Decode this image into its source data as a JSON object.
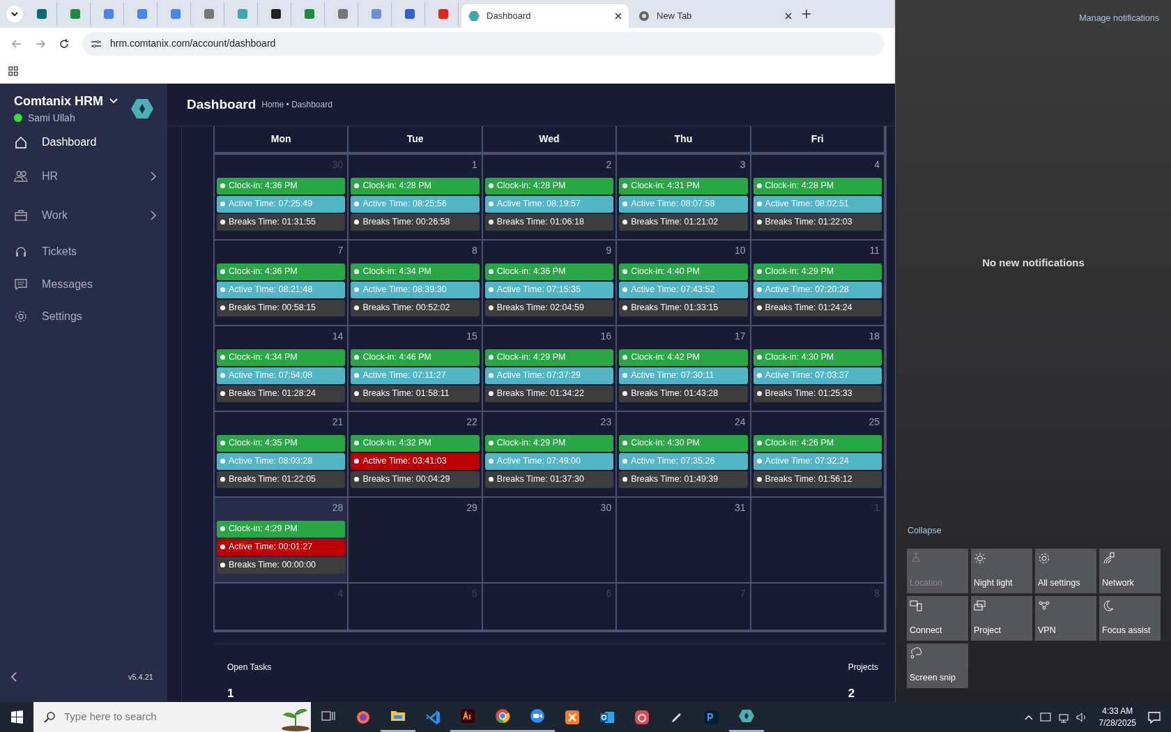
{
  "browser": {
    "tabs": [
      {
        "label": "Dashboard",
        "selected": true
      },
      {
        "label": "New Tab",
        "selected": false
      }
    ],
    "url": "hrm.comtanix.com/account/dashboard"
  },
  "sidebar": {
    "brand": "Comtanix HRM",
    "user": "Sami Ullah",
    "online": true,
    "items": [
      {
        "label": "Dashboard",
        "selected": true,
        "submenu": false
      },
      {
        "label": "HR",
        "selected": false,
        "submenu": true
      },
      {
        "label": "Work",
        "selected": false,
        "submenu": true
      },
      {
        "label": "Tickets",
        "selected": false,
        "submenu": false
      },
      {
        "label": "Messages",
        "selected": false,
        "submenu": false
      },
      {
        "label": "Settings",
        "selected": false,
        "submenu": false
      }
    ],
    "version": "v5.4.21"
  },
  "header": {
    "title": "Dashboard",
    "breadcrumb": "Home • Dashboard"
  },
  "calendar": {
    "weekdays": [
      "Mon",
      "Tue",
      "Wed",
      "Thu",
      "Fri"
    ],
    "weeks": [
      [
        {
          "day": "30",
          "outside": true,
          "today": false,
          "events": [
            {
              "text": "Clock-in: 4:36 PM",
              "color": "#28a745"
            },
            {
              "text": "Active Time: 07:25:49",
              "color": "#4fb6c5"
            },
            {
              "text": "Breaks Time: 01:31:55",
              "color": "#3d3d3d"
            }
          ]
        },
        {
          "day": "1",
          "outside": false,
          "today": false,
          "events": [
            {
              "text": "Clock-in: 4:28 PM",
              "color": "#28a745"
            },
            {
              "text": "Active Time: 08:25:56",
              "color": "#4fb6c5"
            },
            {
              "text": "Breaks Time: 00:26:58",
              "color": "#3d3d3d"
            }
          ]
        },
        {
          "day": "2",
          "outside": false,
          "today": false,
          "events": [
            {
              "text": "Clock-in: 4:28 PM",
              "color": "#28a745"
            },
            {
              "text": "Active Time: 08:19:57",
              "color": "#4fb6c5"
            },
            {
              "text": "Breaks Time: 01:06:18",
              "color": "#3d3d3d"
            }
          ]
        },
        {
          "day": "3",
          "outside": false,
          "today": false,
          "events": [
            {
              "text": "Clock-in: 4:31 PM",
              "color": "#28a745"
            },
            {
              "text": "Active Time: 08:07:58",
              "color": "#4fb6c5"
            },
            {
              "text": "Breaks Time: 01:21:02",
              "color": "#3d3d3d"
            }
          ]
        },
        {
          "day": "4",
          "outside": false,
          "today": false,
          "events": [
            {
              "text": "Clock-in: 4:28 PM",
              "color": "#28a745"
            },
            {
              "text": "Active Time: 08:02:51",
              "color": "#4fb6c5"
            },
            {
              "text": "Breaks Time: 01:22:03",
              "color": "#3d3d3d"
            }
          ]
        }
      ],
      [
        {
          "day": "7",
          "outside": false,
          "today": false,
          "events": [
            {
              "text": "Clock-in: 4:36 PM",
              "color": "#28a745"
            },
            {
              "text": "Active Time: 08:21:48",
              "color": "#4fb6c5"
            },
            {
              "text": "Breaks Time: 00:58:15",
              "color": "#3d3d3d"
            }
          ]
        },
        {
          "day": "8",
          "outside": false,
          "today": false,
          "events": [
            {
              "text": "Clock-in: 4:34 PM",
              "color": "#28a745"
            },
            {
              "text": "Active Time: 08:39:30",
              "color": "#4fb6c5"
            },
            {
              "text": "Breaks Time: 00:52:02",
              "color": "#3d3d3d"
            }
          ]
        },
        {
          "day": "9",
          "outside": false,
          "today": false,
          "events": [
            {
              "text": "Clock-in: 4:36 PM",
              "color": "#28a745"
            },
            {
              "text": "Active Time: 07:15:35",
              "color": "#4fb6c5"
            },
            {
              "text": "Breaks Time: 02:04:59",
              "color": "#3d3d3d"
            }
          ]
        },
        {
          "day": "10",
          "outside": false,
          "today": false,
          "events": [
            {
              "text": "Clock-in: 4:40 PM",
              "color": "#28a745"
            },
            {
              "text": "Active Time: 07:43:52",
              "color": "#4fb6c5"
            },
            {
              "text": "Breaks Time: 01:33:15",
              "color": "#3d3d3d"
            }
          ]
        },
        {
          "day": "11",
          "outside": false,
          "today": false,
          "events": [
            {
              "text": "Clock-in: 4:29 PM",
              "color": "#28a745"
            },
            {
              "text": "Active Time: 07:20:28",
              "color": "#4fb6c5"
            },
            {
              "text": "Breaks Time: 01:24:24",
              "color": "#3d3d3d"
            }
          ]
        }
      ],
      [
        {
          "day": "14",
          "outside": false,
          "today": false,
          "events": [
            {
              "text": "Clock-in: 4:34 PM",
              "color": "#28a745"
            },
            {
              "text": "Active Time: 07:54:08",
              "color": "#4fb6c5"
            },
            {
              "text": "Breaks Time: 01:28:24",
              "color": "#3d3d3d"
            }
          ]
        },
        {
          "day": "15",
          "outside": false,
          "today": false,
          "events": [
            {
              "text": "Clock-in: 4:46 PM",
              "color": "#28a745"
            },
            {
              "text": "Active Time: 07:11:27",
              "color": "#4fb6c5"
            },
            {
              "text": "Breaks Time: 01:58:11",
              "color": "#3d3d3d"
            }
          ]
        },
        {
          "day": "16",
          "outside": false,
          "today": false,
          "events": [
            {
              "text": "Clock-in: 4:29 PM",
              "color": "#28a745"
            },
            {
              "text": "Active Time: 07:37:29",
              "color": "#4fb6c5"
            },
            {
              "text": "Breaks Time: 01:34:22",
              "color": "#3d3d3d"
            }
          ]
        },
        {
          "day": "17",
          "outside": false,
          "today": false,
          "events": [
            {
              "text": "Clock-in: 4:42 PM",
              "color": "#28a745"
            },
            {
              "text": "Active Time: 07:30:11",
              "color": "#4fb6c5"
            },
            {
              "text": "Breaks Time: 01:43:28",
              "color": "#3d3d3d"
            }
          ]
        },
        {
          "day": "18",
          "outside": false,
          "today": false,
          "events": [
            {
              "text": "Clock-in: 4:30 PM",
              "color": "#28a745"
            },
            {
              "text": "Active Time: 07:03:37",
              "color": "#4fb6c5"
            },
            {
              "text": "Breaks Time: 01:25:33",
              "color": "#3d3d3d"
            }
          ]
        }
      ],
      [
        {
          "day": "21",
          "outside": false,
          "today": false,
          "events": [
            {
              "text": "Clock-in: 4:35 PM",
              "color": "#28a745"
            },
            {
              "text": "Active Time: 08:03:28",
              "color": "#4fb6c5"
            },
            {
              "text": "Breaks Time: 01:22:05",
              "color": "#3d3d3d"
            }
          ]
        },
        {
          "day": "22",
          "outside": false,
          "today": false,
          "events": [
            {
              "text": "Clock-in: 4:32 PM",
              "color": "#28a745"
            },
            {
              "text": "Active Time: 03:41:03",
              "color": "#c00000"
            },
            {
              "text": "Breaks Time: 00:04:29",
              "color": "#3d3d3d"
            }
          ]
        },
        {
          "day": "23",
          "outside": false,
          "today": false,
          "events": [
            {
              "text": "Clock-in: 4:29 PM",
              "color": "#28a745"
            },
            {
              "text": "Active Time: 07:49:00",
              "color": "#4fb6c5"
            },
            {
              "text": "Breaks Time: 01:37:30",
              "color": "#3d3d3d"
            }
          ]
        },
        {
          "day": "24",
          "outside": false,
          "today": false,
          "events": [
            {
              "text": "Clock-in: 4:30 PM",
              "color": "#28a745"
            },
            {
              "text": "Active Time: 07:35:26",
              "color": "#4fb6c5"
            },
            {
              "text": "Breaks Time: 01:49:39",
              "color": "#3d3d3d"
            }
          ]
        },
        {
          "day": "25",
          "outside": false,
          "today": false,
          "events": [
            {
              "text": "Clock-in: 4:26 PM",
              "color": "#28a745"
            },
            {
              "text": "Active Time: 07:32:24",
              "color": "#4fb6c5"
            },
            {
              "text": "Breaks Time: 01:56:12",
              "color": "#3d3d3d"
            }
          ]
        }
      ],
      [
        {
          "day": "28",
          "outside": false,
          "today": true,
          "events": [
            {
              "text": "Clock-in: 4:29 PM",
              "color": "#28a745"
            },
            {
              "text": "Active Time: 00:01:27",
              "color": "#c00000"
            },
            {
              "text": "Breaks Time: 00:00:00",
              "color": "#3d3d3d"
            }
          ]
        },
        {
          "day": "29",
          "outside": false,
          "today": false
        },
        {
          "day": "30",
          "outside": false,
          "today": false
        },
        {
          "day": "31",
          "outside": false,
          "today": false
        },
        {
          "day": "1",
          "outside": true,
          "today": false
        }
      ],
      [
        {
          "day": "4",
          "outside": true,
          "today": false
        },
        {
          "day": "5",
          "outside": true,
          "today": false
        },
        {
          "day": "6",
          "outside": true,
          "today": false
        },
        {
          "day": "7",
          "outside": true,
          "today": false
        },
        {
          "day": "8",
          "outside": true,
          "today": false
        }
      ]
    ]
  },
  "stats": [
    {
      "label": "Open Tasks",
      "value": "1"
    },
    {
      "label": "Projects",
      "value": "2"
    }
  ],
  "action_center": {
    "manage": "Manage notifications",
    "empty": "No new notifications",
    "collapse": "Collapse",
    "tiles": [
      {
        "label": "Location",
        "kind": "location",
        "disabled": true
      },
      {
        "label": "Night light",
        "kind": "sun",
        "disabled": false
      },
      {
        "label": "All settings",
        "kind": "gear",
        "disabled": false
      },
      {
        "label": "Network",
        "kind": "network",
        "disabled": false
      },
      {
        "label": "Connect",
        "kind": "connect",
        "disabled": false
      },
      {
        "label": "Project",
        "kind": "project",
        "disabled": false
      },
      {
        "label": "VPN",
        "kind": "vpn",
        "disabled": false
      },
      {
        "label": "Focus assist",
        "kind": "moon",
        "disabled": false
      },
      {
        "label": "Screen snip",
        "kind": "snip",
        "disabled": false
      }
    ]
  },
  "taskbar": {
    "search_placeholder": "Type here to search",
    "apps": [
      {
        "kind": "taskview",
        "running": false
      },
      {
        "kind": "firefox",
        "running": false
      },
      {
        "kind": "folder",
        "running": true
      },
      {
        "kind": "code",
        "running": false
      },
      {
        "kind": "ai",
        "running": true
      },
      {
        "kind": "chrome",
        "running": true
      },
      {
        "kind": "zoom",
        "running": true
      },
      {
        "kind": "xampp",
        "running": false
      },
      {
        "kind": "outlook",
        "running": false
      },
      {
        "kind": "cloud",
        "running": false
      },
      {
        "kind": "pen",
        "running": false
      },
      {
        "kind": "ps",
        "running": false
      },
      {
        "kind": "hex",
        "running": true
      }
    ],
    "time": "4:33 AM",
    "date": "7/28/2025"
  }
}
